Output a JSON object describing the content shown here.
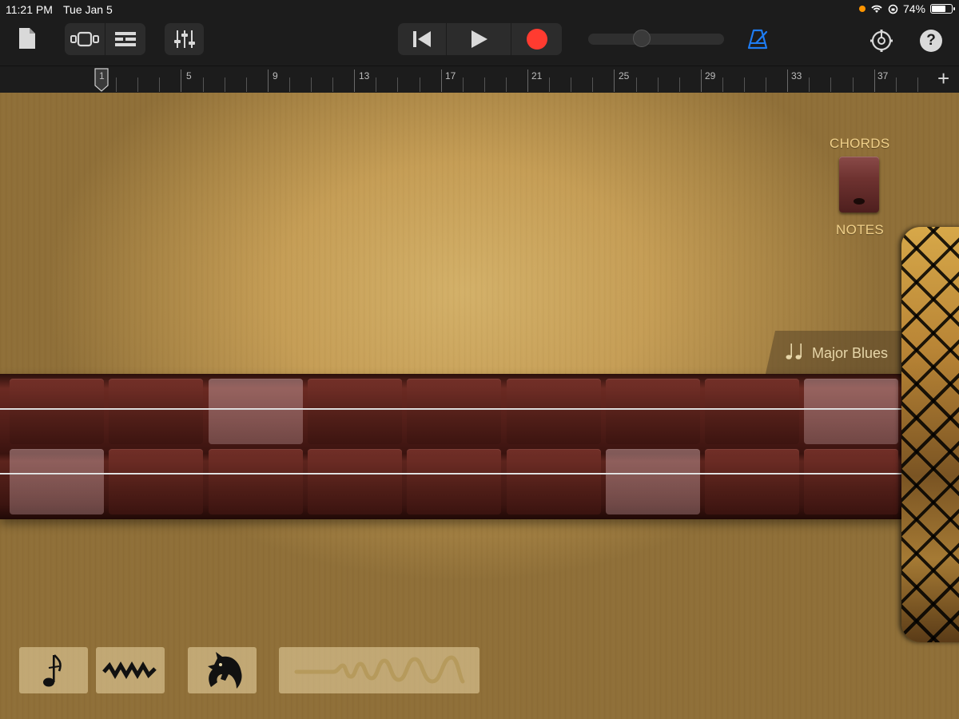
{
  "status_bar": {
    "time": "11:21 PM",
    "date": "Tue Jan 5",
    "battery_percent": "74%",
    "battery_level": 0.74
  },
  "toolbar": {
    "icons": [
      "document-icon",
      "tracks-view-icon",
      "list-view-icon",
      "mixer-icon",
      "go-to-start-icon",
      "play-icon",
      "record-icon",
      "volume-slider",
      "metronome-icon",
      "settings-icon",
      "help-icon"
    ],
    "volume_level": 0.38,
    "help_label": "?",
    "colors": {
      "record": "#ff3b30",
      "metronome": "#1e7cf2",
      "background": "#1c1c1c"
    }
  },
  "ruler": {
    "bar_numbers": [
      "1",
      "5",
      "9",
      "13",
      "17",
      "21",
      "25",
      "29",
      "33",
      "37"
    ],
    "add_label": "+"
  },
  "instrument": {
    "chords_label": "CHORDS",
    "notes_label": "NOTES",
    "scale_name": "Major Blues",
    "string_rows": [
      [
        false,
        false,
        true,
        false,
        false,
        false,
        false,
        false,
        true
      ],
      [
        true,
        false,
        false,
        false,
        false,
        false,
        true,
        false,
        false
      ]
    ]
  },
  "bottom_controls": {
    "icons": [
      "note-icon",
      "vibrato-icon",
      "horse-icon",
      "glissando-icon"
    ]
  }
}
